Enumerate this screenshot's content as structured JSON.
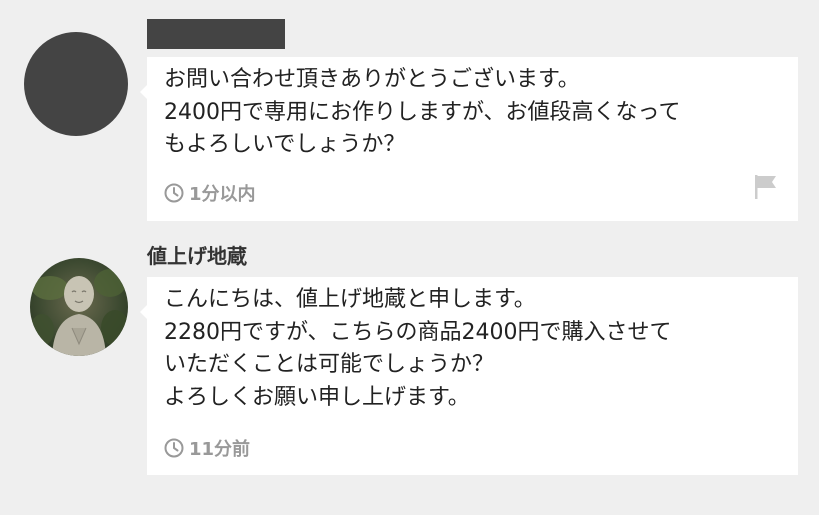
{
  "messages": [
    {
      "sender": "",
      "lines": [
        "お問い合わせ頂きありがとうございます。",
        "2400円で専用にお作りしますが、お値段高くなって",
        "もよろしいでしょうか？"
      ],
      "time": "1分以内",
      "icons": {
        "time": "clock-icon",
        "report": "flag-icon"
      }
    },
    {
      "sender": "値上げ地蔵",
      "lines": [
        "こんにちは、値上げ地蔵と申します。",
        "2280円ですが、こちらの商品2400円で購入させて",
        "いただくことは可能でしょうか？",
        "よろしくお願い申し上げます。"
      ],
      "time": "11分前",
      "icons": {
        "time": "clock-icon"
      }
    }
  ],
  "colors": {
    "background": "#efefef",
    "bubble": "#ffffff",
    "text": "#222222",
    "meta": "#999999",
    "redaction": "#444444"
  }
}
